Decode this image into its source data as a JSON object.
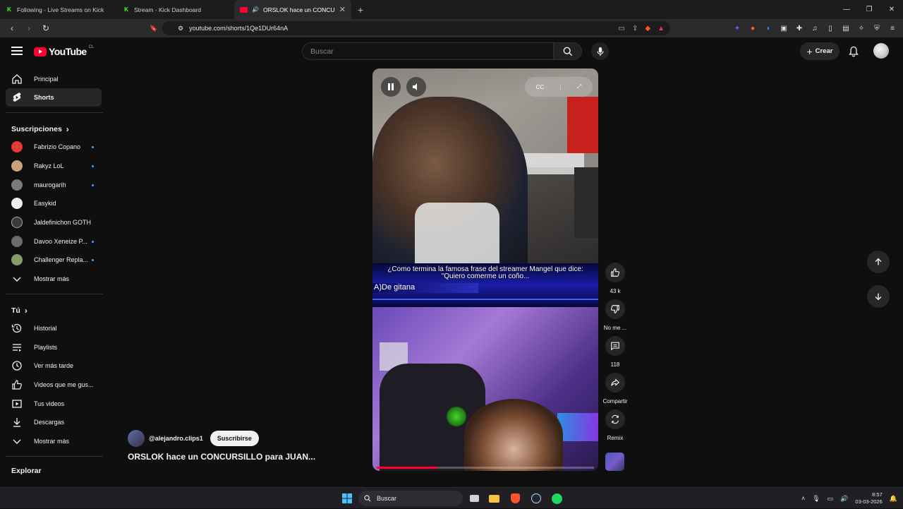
{
  "browser": {
    "tabs": [
      {
        "title": "Following - Live Streams on Kick",
        "icon": "kick-icon",
        "active": false
      },
      {
        "title": "Stream - Kick Dashboard",
        "icon": "kick-icon",
        "active": false
      },
      {
        "title": "ORSLOK hace un CONCURSIL",
        "icon": "youtube-icon",
        "active": true
      }
    ],
    "url": "youtube.com/shorts/1Qe1DUr64nA"
  },
  "header": {
    "logo_text": "YouTube",
    "country_code": "CL",
    "search_placeholder": "Buscar",
    "create_label": "Crear"
  },
  "sidebar": {
    "main": [
      {
        "label": "Principal",
        "icon": "home-icon"
      },
      {
        "label": "Shorts",
        "icon": "shorts-icon",
        "active": true
      }
    ],
    "subscriptions_heading": "Suscripciones",
    "subscriptions": [
      {
        "label": "Fabrizio Copano",
        "color": "#e53935"
      },
      {
        "label": "Rakyz LoL",
        "color": "#c9a27a"
      },
      {
        "label": "maurogarih",
        "color": "#7a7a7a"
      },
      {
        "label": "Easykid",
        "color": "#ededed"
      },
      {
        "label": "Jaldefinichon GOTH",
        "color": "#3a3a3a"
      },
      {
        "label": "Davoo Xeneize P...",
        "color": "#6c6c6c"
      },
      {
        "label": "Challenger Repla...",
        "color": "#8a9a6a"
      }
    ],
    "show_more_1": "Mostrar más",
    "you_heading": "Tú",
    "you_items": [
      {
        "label": "Historial",
        "icon": "history-icon"
      },
      {
        "label": "Playlists",
        "icon": "playlist-icon"
      },
      {
        "label": "Ver más tarde",
        "icon": "clock-icon"
      },
      {
        "label": "Videos que me gus...",
        "icon": "thumbs-up-icon"
      },
      {
        "label": "Tus videos",
        "icon": "video-icon"
      },
      {
        "label": "Descargas",
        "icon": "download-icon"
      }
    ],
    "show_more_2": "Mostrar más",
    "explore_heading": "Explorar"
  },
  "short": {
    "quiz_question": "¿Como termina la famosa frase del streamer Mangel que dice: \"Quiero comerme un coño...",
    "quiz_answer": "A)De gitana",
    "progress": 0.28,
    "channel": "@alejandro.clips1",
    "subscribe_label": "Suscribirse",
    "title": "ORSLOK hace un CONCURSILLO para JUAN..."
  },
  "actions": {
    "likes": "43 k",
    "dislike_label": "No me ...",
    "comments": "118",
    "share_label": "Compartir",
    "remix_label": "Remix"
  },
  "taskbar": {
    "search_placeholder": "Buscar",
    "time": "8:57",
    "date": "03-03-2026"
  }
}
